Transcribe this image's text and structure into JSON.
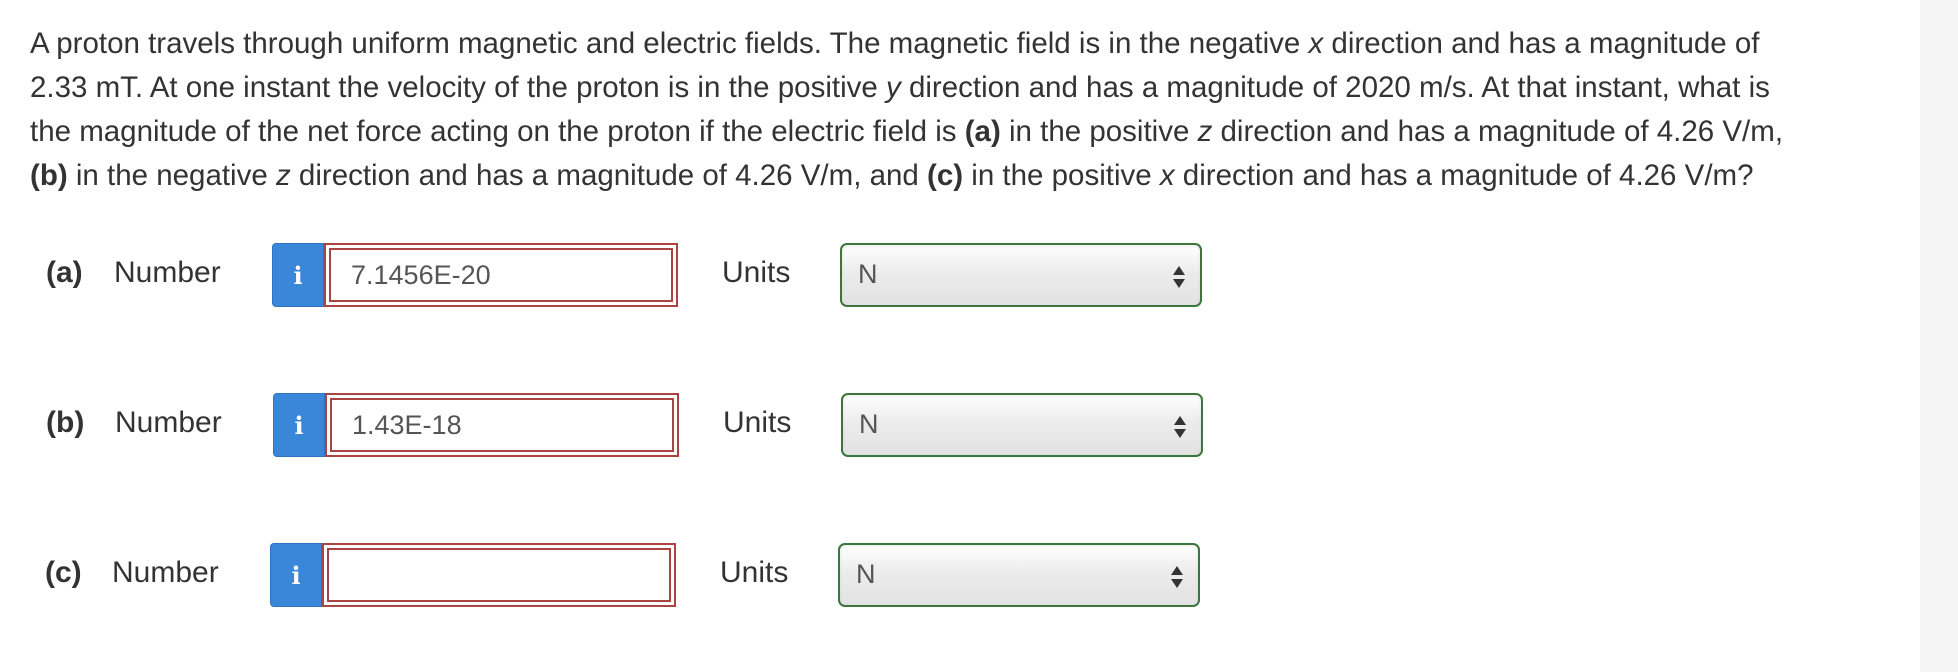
{
  "question": {
    "line1_pre_x": "A proton travels through uniform magnetic and electric fields. The magnetic field is in the negative ",
    "line1_x": "x",
    "line1_post_x": " direction and has a magnitude of",
    "line2_pre_y": "2.33 mT. At one instant the velocity of the proton is in the positive ",
    "line2_y": "y",
    "line2_post_y": " direction and has a magnitude of 2020 m/s. At that instant, what is",
    "line3_pre_a": "the magnitude of the net force acting on the proton if the electric field is ",
    "line3_a": "(a)",
    "line3_mid": " in the positive ",
    "line3_z": "z",
    "line3_post": " direction and has a magnitude of 4.26 V/m,",
    "line4_b": "(b)",
    "line4_mid1": " in the negative ",
    "line4_z": "z",
    "line4_mid2": " direction and has a magnitude of 4.26 V/m, and ",
    "line4_c": "(c)",
    "line4_mid3": " in the positive ",
    "line4_x": "x",
    "line4_post": " direction and has a magnitude of 4.26 V/m?"
  },
  "parts": [
    {
      "label": "(a)",
      "number_label": "Number",
      "info_glyph": "i",
      "answer_value": "7.1456E-20",
      "units_label": "Units",
      "units_value": "N"
    },
    {
      "label": "(b)",
      "number_label": "Number",
      "info_glyph": "i",
      "answer_value": "1.43E-18",
      "units_label": "Units",
      "units_value": "N"
    },
    {
      "label": "(c)",
      "number_label": "Number",
      "info_glyph": "i",
      "answer_value": "",
      "units_label": "Units",
      "units_value": "N"
    }
  ],
  "colors": {
    "info_button": "#3a87d9",
    "answer_border_incorrect": "#a94442",
    "select_border": "#3c763d"
  },
  "icons": {
    "info": "info-icon",
    "select_arrows": "up-down-arrows-icon"
  }
}
